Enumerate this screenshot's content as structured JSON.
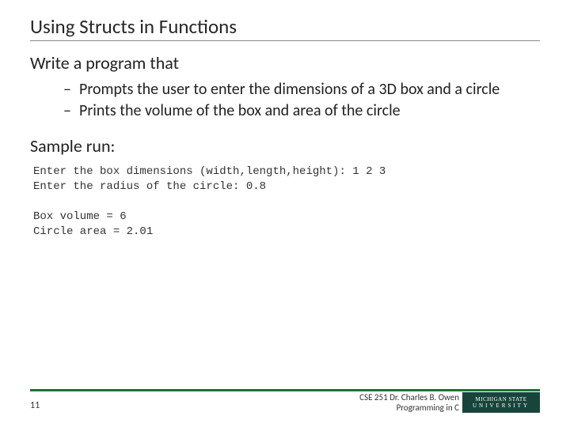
{
  "title": "Using Structs in Functions",
  "intro": "Write a program that",
  "bullets": [
    "Prompts the user to enter the dimensions of a 3D box and a circle",
    "Prints the volume of the box and area of the circle"
  ],
  "sample_label": "Sample run:",
  "code_lines": [
    "Enter the box dimensions (width,length,height): 1 2 3",
    "Enter the radius of the circle: 0.8",
    "",
    "Box volume = 6",
    "Circle area = 2.01"
  ],
  "footer": {
    "slide_number": "11",
    "credit_line1": "CSE 251 Dr. Charles B. Owen",
    "credit_line2": "Programming in C",
    "logo_top": "MICHIGAN STATE",
    "logo_bottom": "UNIVERSITY"
  }
}
